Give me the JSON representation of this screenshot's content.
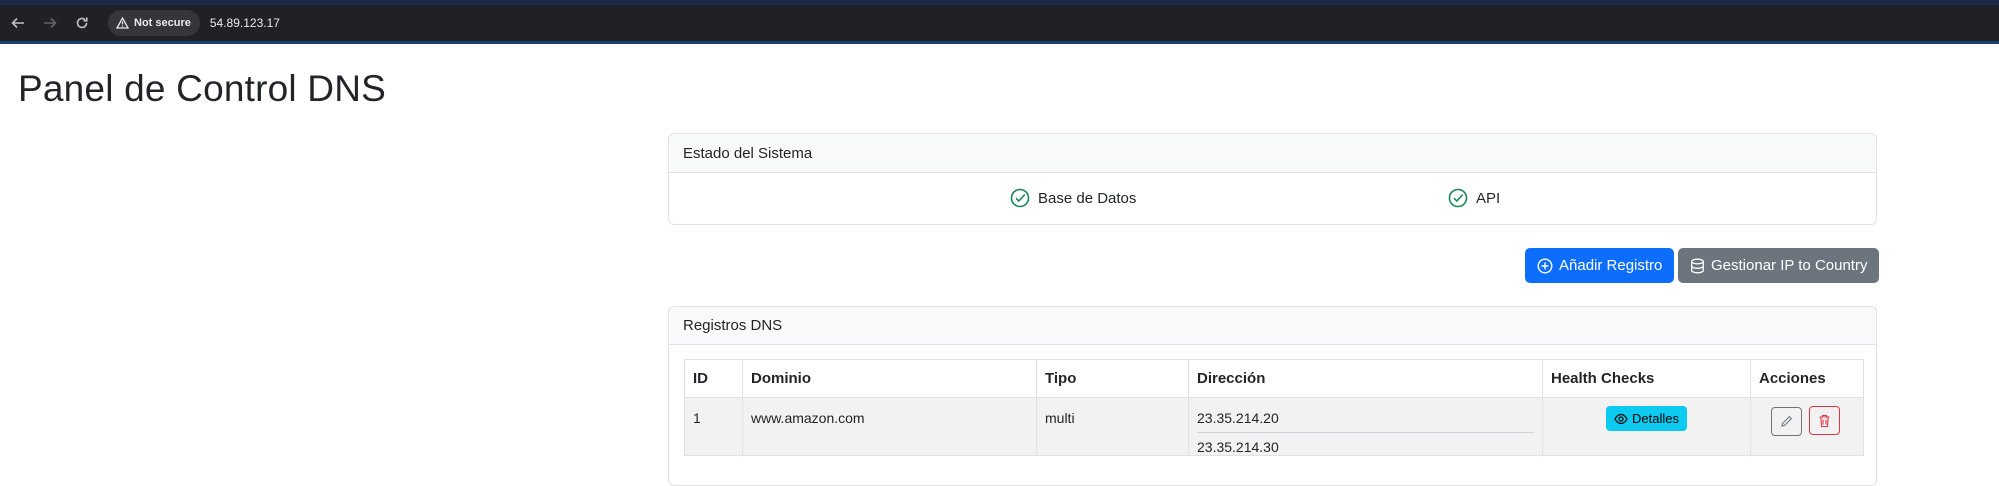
{
  "browser": {
    "security_label": "Not secure",
    "url": "54.89.123.17"
  },
  "page": {
    "title": "Panel de Control DNS"
  },
  "status": {
    "header": "Estado del Sistema",
    "items": [
      {
        "label": "Base de Datos",
        "icon": "check-circle-icon"
      },
      {
        "label": "API",
        "icon": "check-circle-icon"
      }
    ]
  },
  "actions": {
    "add_record": "Añadir Registro",
    "manage_ip": "Gestionar IP to Country"
  },
  "dns": {
    "header": "Registros DNS",
    "columns": [
      "ID",
      "Dominio",
      "Tipo",
      "Dirección",
      "Health Checks",
      "Acciones"
    ],
    "rows": [
      {
        "id": "1",
        "domain": "www.amazon.com",
        "type": "multi",
        "addresses": [
          "23.35.214.20",
          "23.35.214.30"
        ],
        "details_label": "Detalles"
      }
    ]
  },
  "colors": {
    "primary": "#0d6efd",
    "secondary": "#6c757d",
    "info": "#0dcaf0",
    "danger": "#dc3545",
    "success": "#198754"
  }
}
